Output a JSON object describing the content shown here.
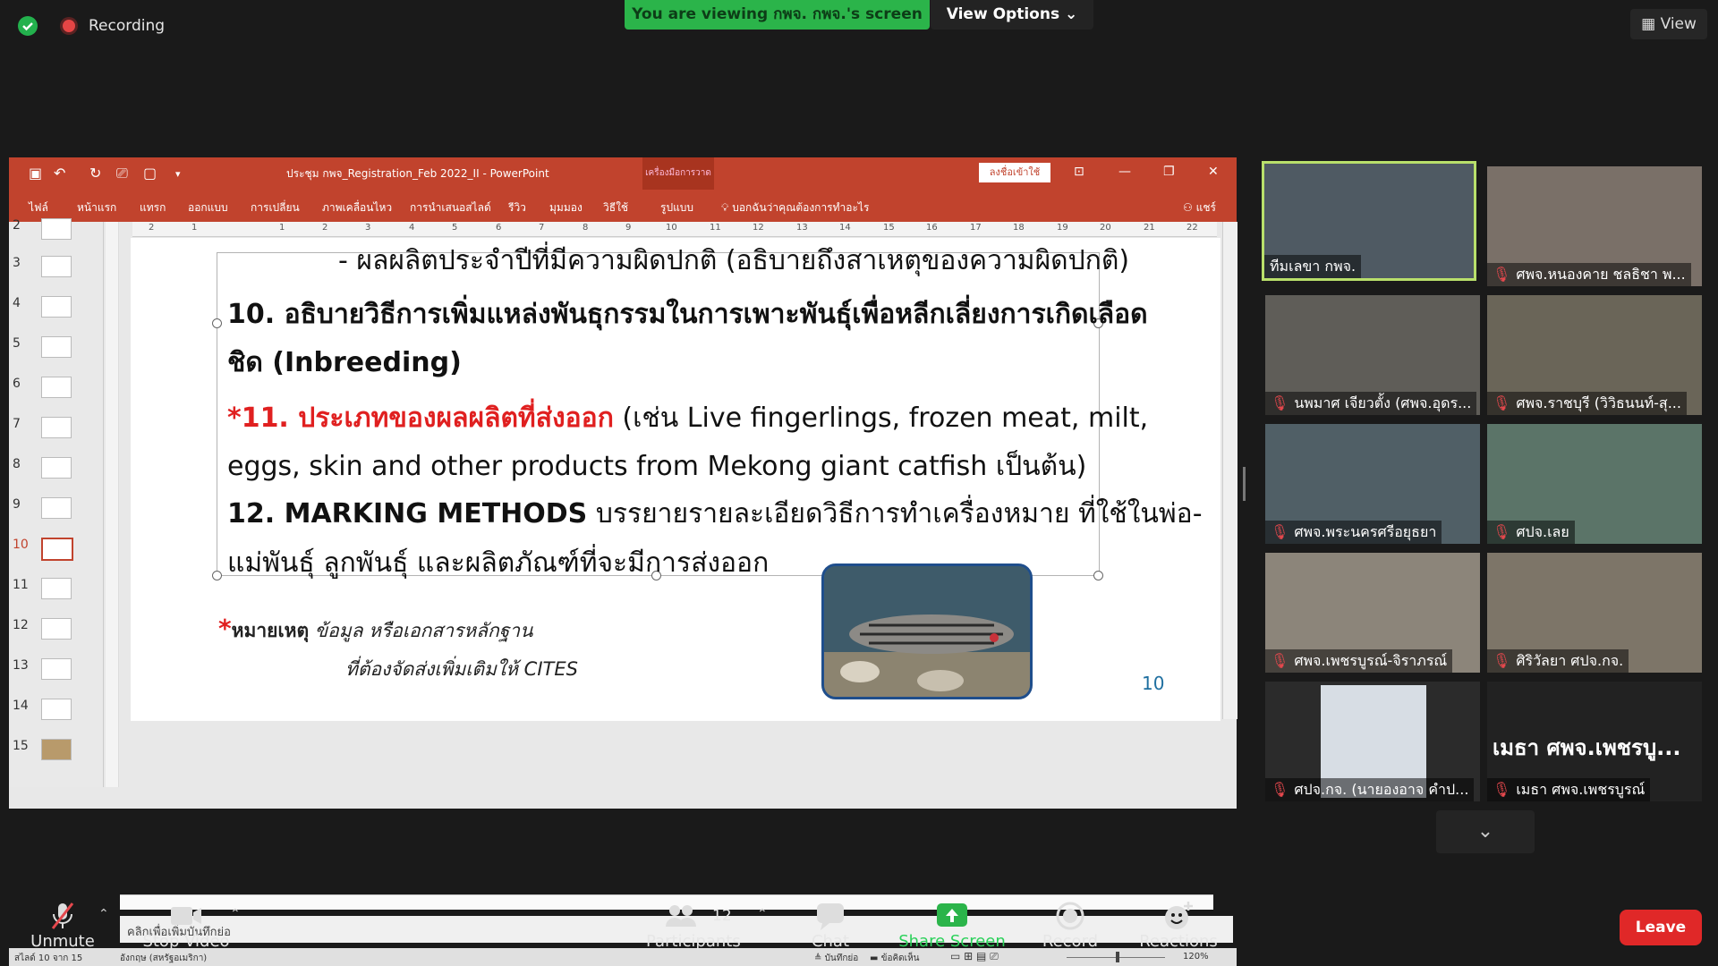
{
  "top": {
    "recording_label": "Recording",
    "viewing_banner": "You are viewing กพจ. กพจ.'s screen",
    "view_options": "View Options",
    "view_button": "View"
  },
  "ppt": {
    "title": "ประชุม กพจ_Registration_Feb 2022_II  -  PowerPoint",
    "context_tab": "เครื่องมือการวาด",
    "signin": "ลงชื่อเข้าใช้",
    "ribbon": [
      "ไฟล์",
      "หน้าแรก",
      "แทรก",
      "ออกแบบ",
      "การเปลี่ยน",
      "ภาพเคลื่อนไหว",
      "การนำเสนอสไลด์",
      "รีวิว",
      "มุมมอง",
      "วิธีใช้",
      "รูปแบบ"
    ],
    "tell_me": "บอกฉันว่าคุณต้องการทำอะไร",
    "share": "แชร์",
    "thumb_numbers": [
      "2",
      "3",
      "4",
      "5",
      "6",
      "7",
      "8",
      "9",
      "10",
      "11",
      "12",
      "13",
      "14",
      "15"
    ],
    "selected_slide": "10",
    "ruler_numbers": [
      "2",
      "1",
      "1",
      "2",
      "3",
      "4",
      "5",
      "6",
      "7",
      "8",
      "9",
      "10",
      "11",
      "12",
      "13",
      "14",
      "15",
      "16",
      "17",
      "18",
      "19",
      "20",
      "21",
      "22"
    ],
    "notes_placeholder": "คลิกเพื่อเพิ่มบันทึกย่อ",
    "status_slide": "สไลด์ 10 จาก 15",
    "status_lang": "อังกฤษ (สหรัฐอเมริกา)",
    "status_notes": "บันทึกย่อ",
    "status_comments": "ข้อคิดเห็น",
    "zoom": "120%"
  },
  "slide": {
    "line1": "- ผลผลิตประจำปีที่มีความผิดปกติ (อธิบายถึงสาเหตุของความผิดปกติ)",
    "item10": "10. อธิบายวิธีการเพิ่มแหล่งพันธุกรรมในการเพาะพันธุ์เพื่อหลีกเลี่ยงการเกิดเลือด",
    "item10b": "ชิด (Inbreeding)",
    "item11_red": "*11. ประเภทของผลผลิตที่ส่งออก",
    "item11_rest": " (เช่น Live fingerlings, frozen meat, milt,",
    "item11b": "eggs, skin and other products from Mekong giant catfish เป็นต้น)",
    "item12_bold": "12. MARKING METHODS",
    "item12_rest": " บรรยายรายละเอียดวิธีการทำเครื่องหมาย ที่ใช้ในพ่อ-",
    "item12b": "แม่พันธุ์  ลูกพันธุ์ และผลิตภัณฑ์ที่จะมีการส่งออก",
    "note_star": "*",
    "note_label": "หมายเหตุ",
    "note_text1": " ข้อมูล หรือเอกสารหลักฐาน",
    "note_text2": "ที่ต้องจัดส่งเพิ่มเติมให้ CITES",
    "page_number": "10"
  },
  "gallery": [
    {
      "name": "ทีมเลขา กพจ.",
      "muted": false,
      "active": true
    },
    {
      "name": "ศพจ.หนองคาย ชลธิชา  พ...",
      "muted": true,
      "active": false
    },
    {
      "name": "นพมาศ เจียวตั้ง (ศพจ.อุดร...",
      "muted": true,
      "active": false
    },
    {
      "name": "ศพจ.ราชบุรี (วิวิธนนท์-สุ...",
      "muted": true,
      "active": false
    },
    {
      "name": "ศพจ.พระนครศรีอยุธยา",
      "muted": true,
      "active": false
    },
    {
      "name": "ศปจ.เลย",
      "muted": true,
      "active": false
    },
    {
      "name": "ศพจ.เพชรบูรณ์-จิราภรณ์",
      "muted": true,
      "active": false
    },
    {
      "name": "ศิริวัลยา ศปจ.กจ.",
      "muted": true,
      "active": false
    },
    {
      "name": "ศปจ.กจ. (นายองอาจ คำป...",
      "muted": true,
      "active": false
    },
    {
      "name": "เมธา ศพจ.เพชรบูรณ์",
      "muted": true,
      "active": false
    }
  ],
  "gallery_big_text": "เมธา ศพจ.เพชรบู...",
  "toolbar": {
    "unmute": "Unmute",
    "stop_video": "Stop Video",
    "participants": "Participants",
    "participants_count": "12",
    "chat": "Chat",
    "share_screen": "Share Screen",
    "record": "Record",
    "reactions": "Reactions",
    "leave": "Leave"
  },
  "colors": {
    "ppt_red": "#c1432d",
    "zoom_green": "#2bb44a",
    "leave_red": "#e02828",
    "active_border": "#b9e06b"
  }
}
